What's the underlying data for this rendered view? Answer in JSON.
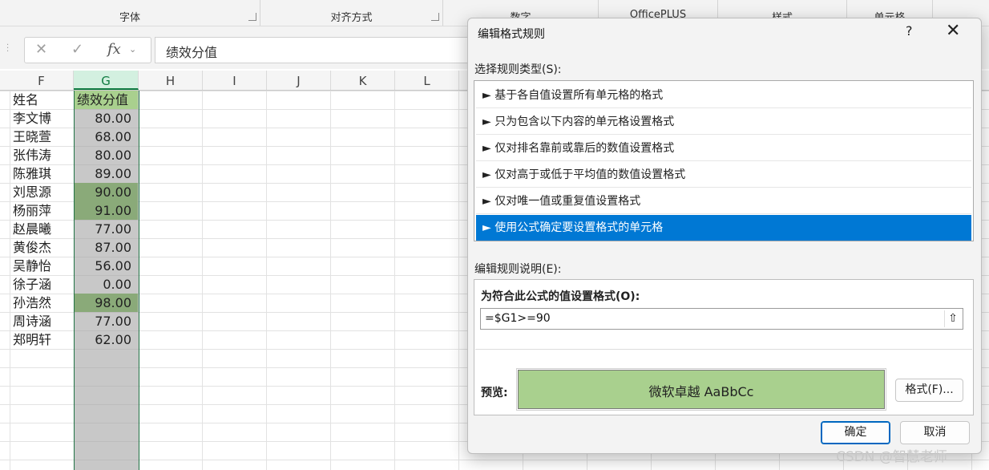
{
  "ribbon": {
    "groups": [
      "字体",
      "对齐方式",
      "数字",
      "OfficePLUS",
      "样式",
      "单元格"
    ]
  },
  "formula_bar": {
    "cancel_icon": "✕",
    "enter_icon": "✓",
    "fx_label": "fx",
    "content": "绩效分值"
  },
  "sheet": {
    "columns": [
      "F",
      "G",
      "H",
      "I",
      "J",
      "K",
      "L"
    ],
    "header": {
      "name": "姓名",
      "score": "绩效分值"
    },
    "rows": [
      {
        "name": "李文博",
        "score": "80.00",
        "highlight": false
      },
      {
        "name": "王晓萱",
        "score": "68.00",
        "highlight": false
      },
      {
        "name": "张伟涛",
        "score": "80.00",
        "highlight": false
      },
      {
        "name": "陈雅琪",
        "score": "89.00",
        "highlight": false
      },
      {
        "name": "刘思源",
        "score": "90.00",
        "highlight": true
      },
      {
        "name": "杨丽萍",
        "score": "91.00",
        "highlight": true
      },
      {
        "name": "赵晨曦",
        "score": "77.00",
        "highlight": false
      },
      {
        "name": "黄俊杰",
        "score": "87.00",
        "highlight": false
      },
      {
        "name": "吴静怡",
        "score": "56.00",
        "highlight": false
      },
      {
        "name": "徐子涵",
        "score": "0.00",
        "highlight": false
      },
      {
        "name": "孙浩然",
        "score": "98.00",
        "highlight": true
      },
      {
        "name": "周诗涵",
        "score": "77.00",
        "highlight": false
      },
      {
        "name": "郑明轩",
        "score": "62.00",
        "highlight": false
      }
    ]
  },
  "dialog": {
    "title": "编辑格式规则",
    "help": "?",
    "close": "✕",
    "rule_type_label": "选择规则类型(S):",
    "rules": [
      "► 基于各自值设置所有单元格的格式",
      "► 只为包含以下内容的单元格设置格式",
      "► 仅对排名靠前或靠后的数值设置格式",
      "► 仅对高于或低于平均值的数值设置格式",
      "► 仅对唯一值或重复值设置格式",
      "► 使用公式确定要设置格式的单元格"
    ],
    "selected_rule_index": 5,
    "edit_desc_label": "编辑规则说明(E):",
    "formula_label": "为符合此公式的值设置格式(O):",
    "formula_value": "=$G1>=90",
    "preview_label": "预览:",
    "preview_text": "微软卓越  AaBbCc",
    "format_button": "格式(F)...",
    "ok_button": "确定",
    "cancel_button": "取消"
  },
  "watermark": "CSDN @智慧老师",
  "colors": {
    "accent": "#0078d4",
    "excel_green": "#217346",
    "preview_fill": "#a9d08e",
    "highlight_fill": "#8aaa79",
    "column_fill": "#c8c8c8"
  }
}
